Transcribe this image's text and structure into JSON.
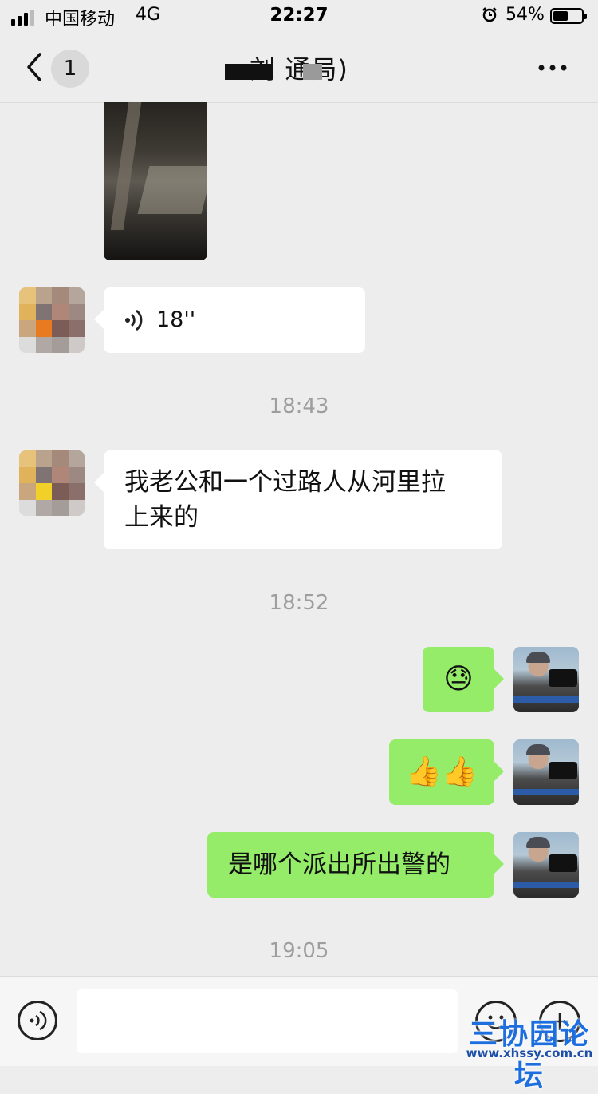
{
  "status_bar": {
    "carrier": "中国移动",
    "network": "4G",
    "time": "22:27",
    "battery": "54%",
    "battery_level": 0.54
  },
  "nav": {
    "unread_count": "1",
    "title": "刘        通局)"
  },
  "messages": [
    {
      "type": "image",
      "side": "left"
    },
    {
      "type": "voice",
      "side": "left",
      "duration": "18''"
    },
    {
      "type": "time",
      "text": "18:43"
    },
    {
      "type": "text",
      "side": "left",
      "text_line1": "我老公和一个过路人从河里拉",
      "text_line2": "上来的"
    },
    {
      "type": "time",
      "text": "18:52"
    },
    {
      "type": "emoji",
      "side": "right",
      "emoji": "😓"
    },
    {
      "type": "emoji",
      "side": "right",
      "emoji": "👍👍"
    },
    {
      "type": "text",
      "side": "right",
      "text": "是哪个派出所出警的"
    },
    {
      "type": "time",
      "text": "19:05"
    }
  ],
  "watermark": {
    "title": "三协园论坛",
    "url": "www.xhssy.com.cn"
  }
}
